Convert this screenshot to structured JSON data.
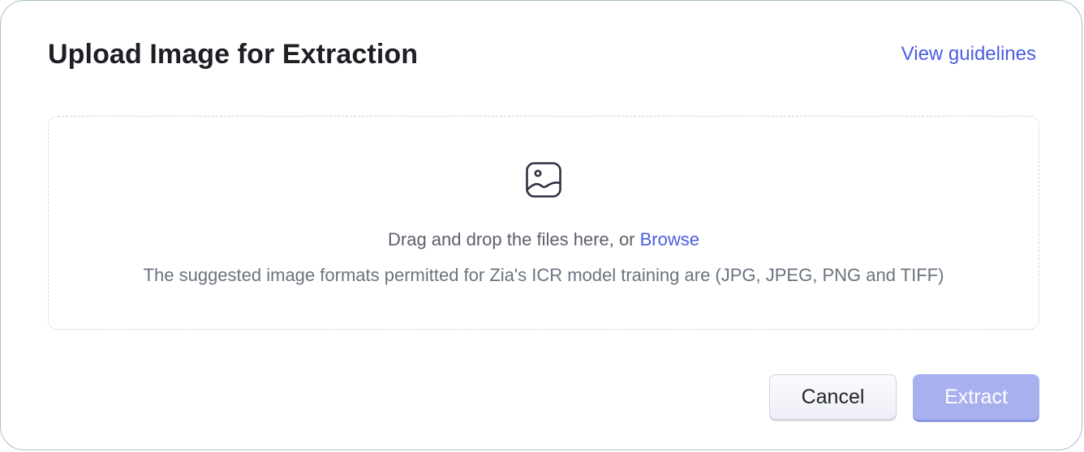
{
  "dialog": {
    "title": "Upload Image for Extraction",
    "guidelines_link": "View guidelines"
  },
  "dropzone": {
    "icon": "image-icon",
    "prompt_text": "Drag and drop the files here, or ",
    "browse_label": "Browse",
    "formats_text": "The suggested image formats permitted for Zia's ICR model training are (JPG, JPEG, PNG and TIFF)"
  },
  "actions": {
    "cancel_label": "Cancel",
    "extract_label": "Extract"
  },
  "colors": {
    "accent": "#4a5de0",
    "extract_disabled": "#a8b0ef",
    "border": "#a9c0c8"
  }
}
